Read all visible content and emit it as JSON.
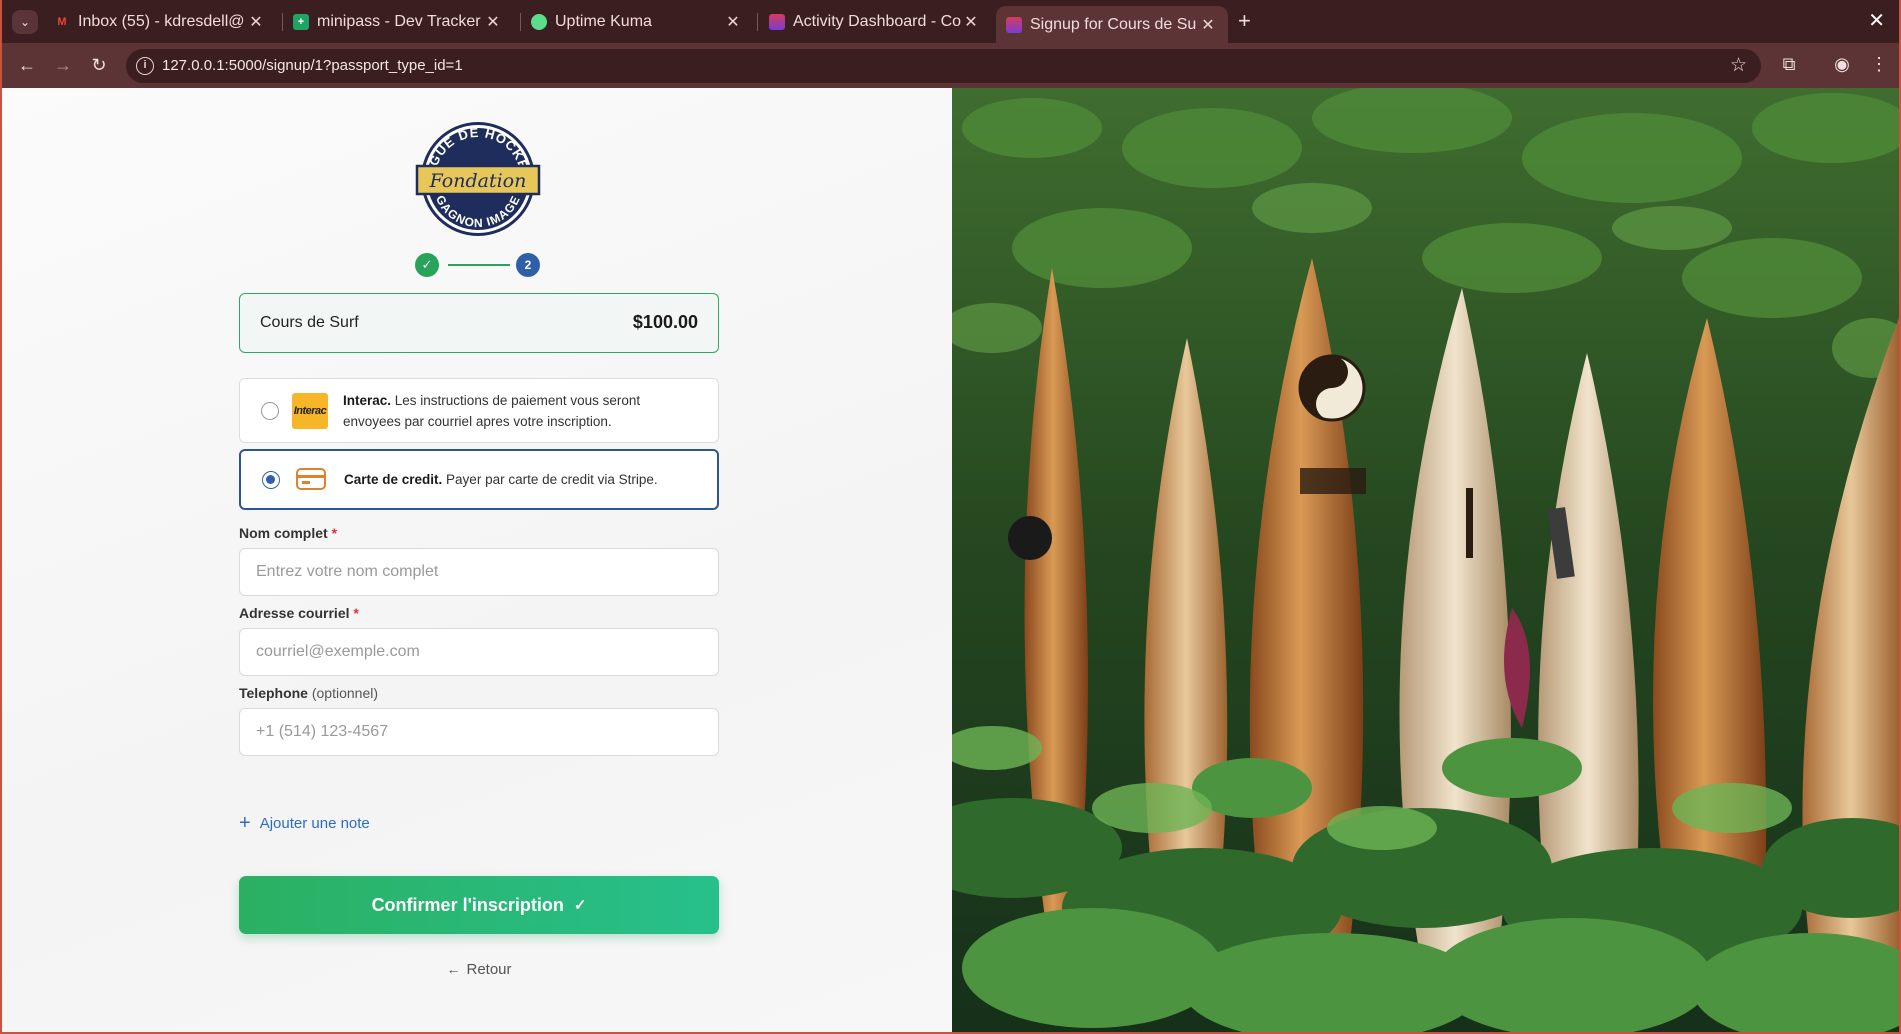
{
  "browser": {
    "tabs": [
      {
        "title": "Inbox (55) - kdresdell@",
        "favicon": "gmail-icon",
        "favicon_color": "#ea4335"
      },
      {
        "title": "minipass - Dev Tracker",
        "favicon": "sheets-icon",
        "favicon_color": "#1fa463"
      },
      {
        "title": "Uptime Kuma",
        "favicon": "uptime-kuma-icon",
        "favicon_color": "#5cdd8b"
      },
      {
        "title": "Activity Dashboard - Co",
        "favicon": "minipass-icon",
        "favicon_color": "#d43c5c"
      },
      {
        "title": "Signup for Cours de Su",
        "favicon": "minipass-icon",
        "favicon_color": "#d43c5c",
        "active": true
      }
    ],
    "close_glyph": "✕",
    "url": "127.0.0.1:5000/signup/1?passport_type_id=1"
  },
  "logo": {
    "top_text": "LIGUE DE HOCKEY",
    "middle_text": "Fondation",
    "bottom_text": "GAGNON IMAGE",
    "colors": {
      "navy": "#1f2d5c",
      "gold": "#e8c75a"
    }
  },
  "stepper": {
    "done_glyph": "✓",
    "current_step": "2"
  },
  "summary": {
    "activity": "Cours de Surf",
    "price": "$100.00"
  },
  "payment": {
    "interac": {
      "icon_text": "Interac",
      "title": "Interac.",
      "description": " Les instructions de paiement vous seront envoyees par courriel apres votre inscription."
    },
    "card": {
      "title": "Carte de credit.",
      "description": " Payer par carte de credit via Stripe.",
      "selected": true
    }
  },
  "form": {
    "name_label": "Nom complet",
    "name_placeholder": "Entrez votre nom complet",
    "email_label": "Adresse courriel",
    "email_placeholder": "courriel@exemple.com",
    "phone_label": "Telephone",
    "phone_optional": "(optionnel)",
    "phone_placeholder": "+1 (514) 123-4567",
    "required_mark": "*"
  },
  "add_note": "Ajouter une note",
  "confirm_button": "Confirmer l'inscription",
  "back_link": "Retour",
  "colors": {
    "accent_green": "#2bb062",
    "accent_blue": "#2d5494",
    "orange": "#e0822c"
  },
  "hero_image": {
    "description": "surfboards-among-tropical-plants"
  }
}
